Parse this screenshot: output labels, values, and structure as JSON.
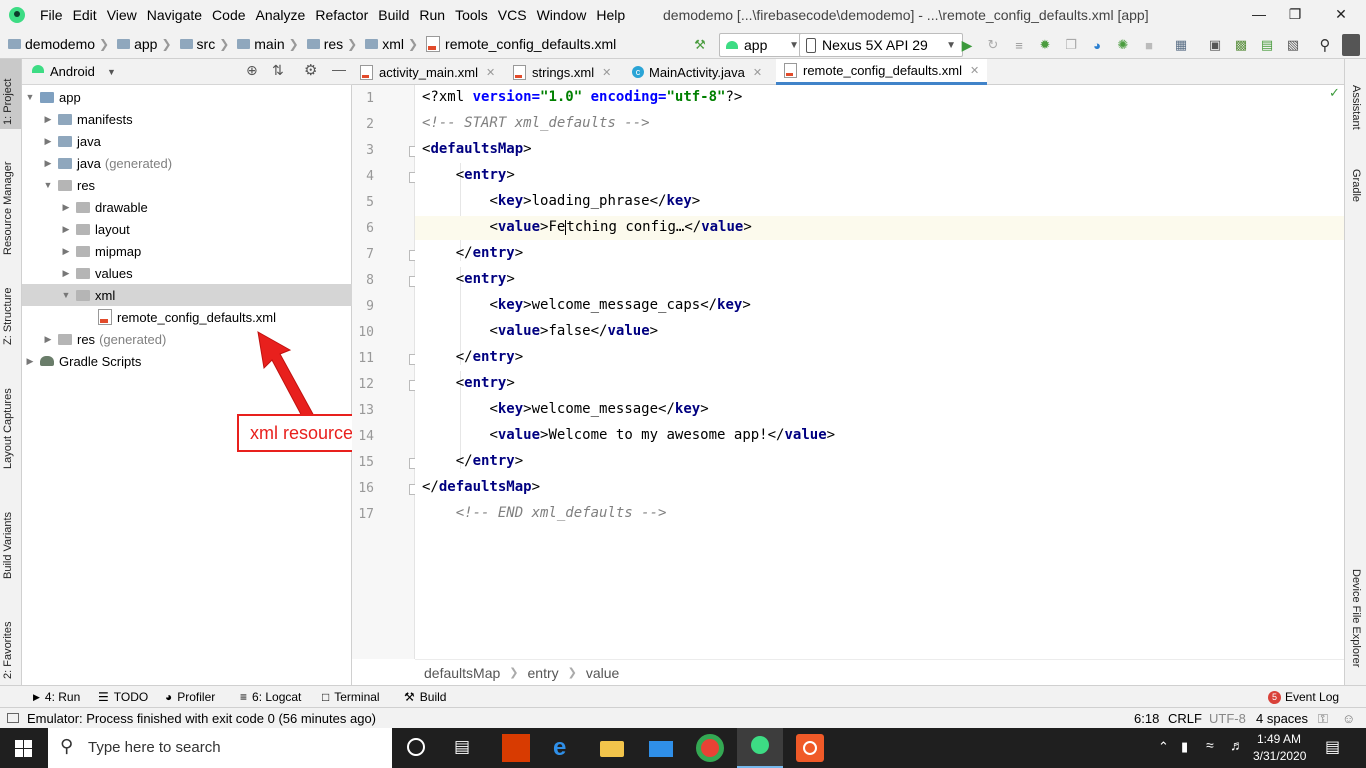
{
  "menu": [
    "File",
    "Edit",
    "View",
    "Navigate",
    "Code",
    "Analyze",
    "Refactor",
    "Build",
    "Run",
    "Tools",
    "VCS",
    "Window",
    "Help"
  ],
  "window_title": "demodemo [...\\firebasecode\\demodemo] - ...\\remote_config_defaults.xml [app]",
  "breadcrumbs": [
    "demodemo",
    "app",
    "src",
    "main",
    "res",
    "xml",
    "remote_config_defaults.xml"
  ],
  "run_config": "app",
  "device": "Nexus 5X API 29",
  "project_view": "Android",
  "tree": [
    {
      "label": "app",
      "hint": ""
    },
    {
      "label": "manifests",
      "hint": ""
    },
    {
      "label": "java",
      "hint": ""
    },
    {
      "label": "java",
      "hint": "(generated)"
    },
    {
      "label": "res",
      "hint": ""
    },
    {
      "label": "drawable",
      "hint": ""
    },
    {
      "label": "layout",
      "hint": ""
    },
    {
      "label": "mipmap",
      "hint": ""
    },
    {
      "label": "values",
      "hint": ""
    },
    {
      "label": "xml",
      "hint": ""
    },
    {
      "label": "remote_config_defaults.xml",
      "hint": ""
    },
    {
      "label": "res",
      "hint": "(generated)"
    },
    {
      "label": "Gradle Scripts",
      "hint": ""
    }
  ],
  "tabs": [
    "activity_main.xml",
    "strings.xml",
    "MainActivity.java",
    "remote_config_defaults.xml"
  ],
  "code": {
    "l1": {
      "open": "<?xml ",
      "a1": "version=",
      "v1": "\"1.0\"",
      "sp": " ",
      "a2": "encoding=",
      "v2": "\"utf-8\"",
      "close": "?>"
    },
    "l2": "<!-- START xml_defaults -->",
    "l3": {
      "lt": "<",
      "tag": "defaultsMap",
      "gt": ">"
    },
    "l4": {
      "ind": "    ",
      "lt": "<",
      "tag": "entry",
      "gt": ">"
    },
    "l5": {
      "ind": "        ",
      "lt": "<",
      "tag": "key",
      "gt": ">",
      "text": "loading_phrase",
      "lt2": "</",
      "tag2": "key",
      "gt2": ">"
    },
    "l6": {
      "ind": "        ",
      "lt": "<",
      "tag": "value",
      "gt": ">",
      "text_a": "Fe",
      "text_b": "tching config…",
      "lt2": "</",
      "tag2": "value",
      "gt2": ">"
    },
    "l7": {
      "ind": "    ",
      "lt": "</",
      "tag": "entry",
      "gt": ">"
    },
    "l8": {
      "ind": "    ",
      "lt": "<",
      "tag": "entry",
      "gt": ">"
    },
    "l9": {
      "ind": "        ",
      "lt": "<",
      "tag": "key",
      "gt": ">",
      "text": "welcome_message_caps",
      "lt2": "</",
      "tag2": "key",
      "gt2": ">"
    },
    "l10": {
      "ind": "        ",
      "lt": "<",
      "tag": "value",
      "gt": ">",
      "text": "false",
      "lt2": "</",
      "tag2": "value",
      "gt2": ">"
    },
    "l11": {
      "ind": "    ",
      "lt": "</",
      "tag": "entry",
      "gt": ">"
    },
    "l12": {
      "ind": "    ",
      "lt": "<",
      "tag": "entry",
      "gt": ">"
    },
    "l13": {
      "ind": "        ",
      "lt": "<",
      "tag": "key",
      "gt": ">",
      "text": "welcome_message",
      "lt2": "</",
      "tag2": "key",
      "gt2": ">"
    },
    "l14": {
      "ind": "        ",
      "lt": "<",
      "tag": "value",
      "gt": ">",
      "text": "Welcome to my awesome app!",
      "lt2": "</",
      "tag2": "value",
      "gt2": ">"
    },
    "l15": {
      "ind": "    ",
      "lt": "</",
      "tag": "entry",
      "gt": ">"
    },
    "l16": {
      "lt": "</",
      "tag": "defaultsMap",
      "gt": ">"
    },
    "l17": "    <!-- END xml_defaults -->"
  },
  "line_numbers": [
    "1",
    "2",
    "3",
    "4",
    "5",
    "6",
    "7",
    "8",
    "9",
    "10",
    "11",
    "12",
    "13",
    "14",
    "15",
    "16",
    "17"
  ],
  "editor_breadcrumbs": [
    "defaultsMap",
    "entry",
    "value"
  ],
  "left_tools": [
    "1: Project",
    "Resource Manager",
    "Z: Structure",
    "Layout Captures",
    "Build Variants",
    "2: Favorites"
  ],
  "right_tools": [
    "Assistant",
    "Gradle",
    "Device File Explorer"
  ],
  "bottom_tools": [
    "4: Run",
    "TODO",
    "Profiler",
    "6: Logcat",
    "Terminal",
    "Build"
  ],
  "event_log": {
    "count": "5",
    "label": "Event Log"
  },
  "status": {
    "message": "Emulator: Process finished with exit code 0 (56 minutes ago)",
    "position": "6:18",
    "line_sep": "CRLF",
    "encoding": "UTF-8",
    "indent": "4 spaces"
  },
  "taskbar": {
    "search_placeholder": "Type here to search",
    "time": "1:49 AM",
    "date": "3/31/2020"
  },
  "annotation": "xml resource file",
  "colors": {
    "accent": "#4083c9",
    "annotation": "#e8201d",
    "tag": "#000080",
    "string": "#008000",
    "comment": "#808080"
  }
}
